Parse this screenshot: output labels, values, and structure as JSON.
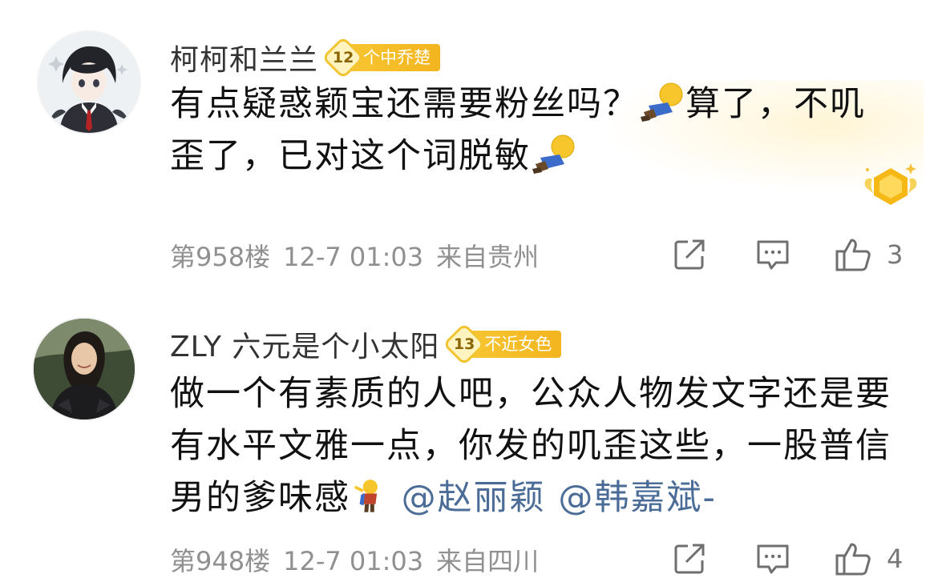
{
  "comments": [
    {
      "username": "柯柯和兰兰",
      "badge_level": "12",
      "badge_text": "个中乔楚",
      "lines": [
        {
          "before": "有点疑惑颖宝还需要粉丝吗？",
          "emoji": "doge-figure-emoji",
          "after": "算了，不叽"
        },
        {
          "before": "歪了，已对这个词脱敏",
          "emoji": "doge-figure-emoji",
          "after": ""
        }
      ],
      "floor": "第958楼",
      "time": "12-7 01:03",
      "location": "来自贵州",
      "like_count": "3"
    },
    {
      "username": "ZLY 六元是个小太阳",
      "badge_level": "13",
      "badge_text": "不近女色",
      "lines": [
        {
          "before": "做一个有素质的人吧，公众人物发文字还是要"
        },
        {
          "before": "有水平文雅一点，你发的叽歪这些，一股普信"
        },
        {
          "before": "男的爹味感",
          "emoji": "salute-figure-emoji",
          "mention1": "@赵丽颖",
          "mention2": "@韩嘉斌-"
        }
      ],
      "floor": "第948楼",
      "time": "12-7 01:03",
      "location": "来自四川",
      "like_count": "4"
    }
  ],
  "icons": {
    "share": "share-icon",
    "comment": "comment-icon",
    "like": "thumbs-up-icon",
    "medal": "gold-medal-icon"
  },
  "colors": {
    "text": "#111111",
    "meta": "#909090",
    "mention": "#4a6c97",
    "badge": "#f3c431"
  }
}
